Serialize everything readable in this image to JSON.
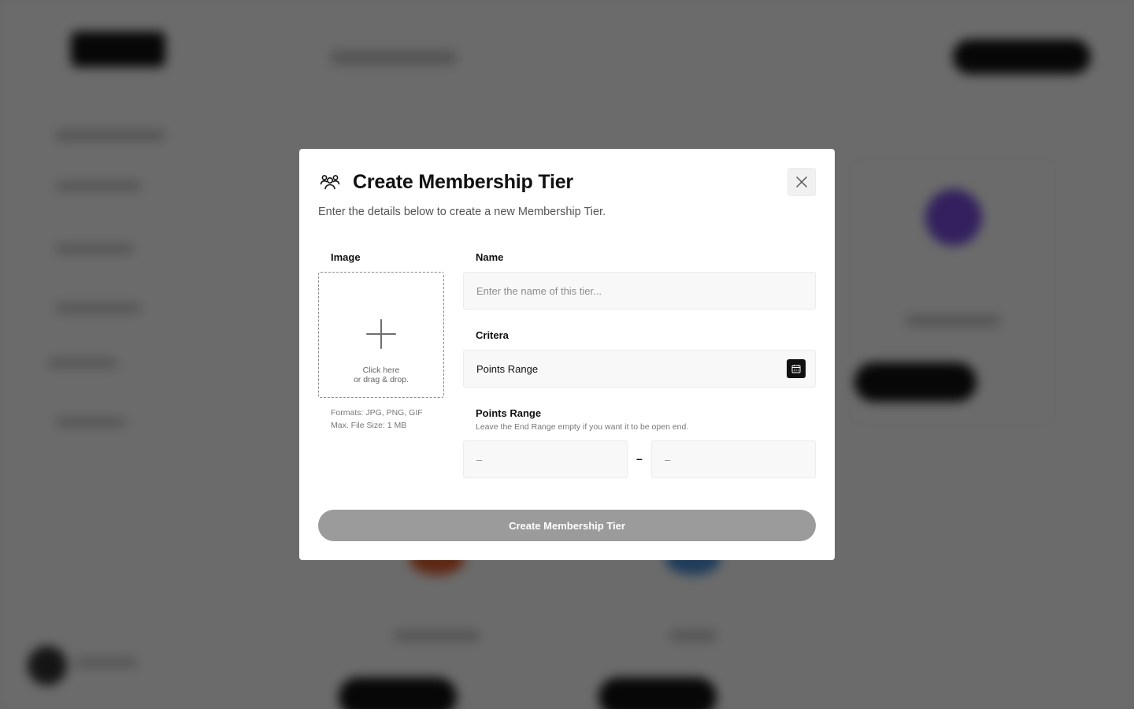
{
  "modal": {
    "title": "Create Membership Tier",
    "description": "Enter the details below to create a new Membership Tier.",
    "close_icon": "close-icon",
    "header_icon": "users-icon"
  },
  "image": {
    "label": "Image",
    "dropzone_line1": "Click here",
    "dropzone_line2": "or drag & drop.",
    "formats": "Formats: JPG, PNG, GIF",
    "max_size": "Max. File Size: 1 MB"
  },
  "name": {
    "label": "Name",
    "placeholder": "Enter the name of this tier...",
    "value": ""
  },
  "criteria": {
    "label": "Critera",
    "selected": "Points Range",
    "icon": "calendar-icon"
  },
  "points_range": {
    "label": "Points Range",
    "hint": "Leave the End Range empty if you want it to be open end.",
    "start_placeholder": "–",
    "end_placeholder": "–",
    "separator": "–"
  },
  "submit": {
    "label": "Create Membership Tier"
  },
  "colors": {
    "overlay": "#000000",
    "submit_disabled": "#9b9b9b",
    "accent_dark": "#111111"
  }
}
